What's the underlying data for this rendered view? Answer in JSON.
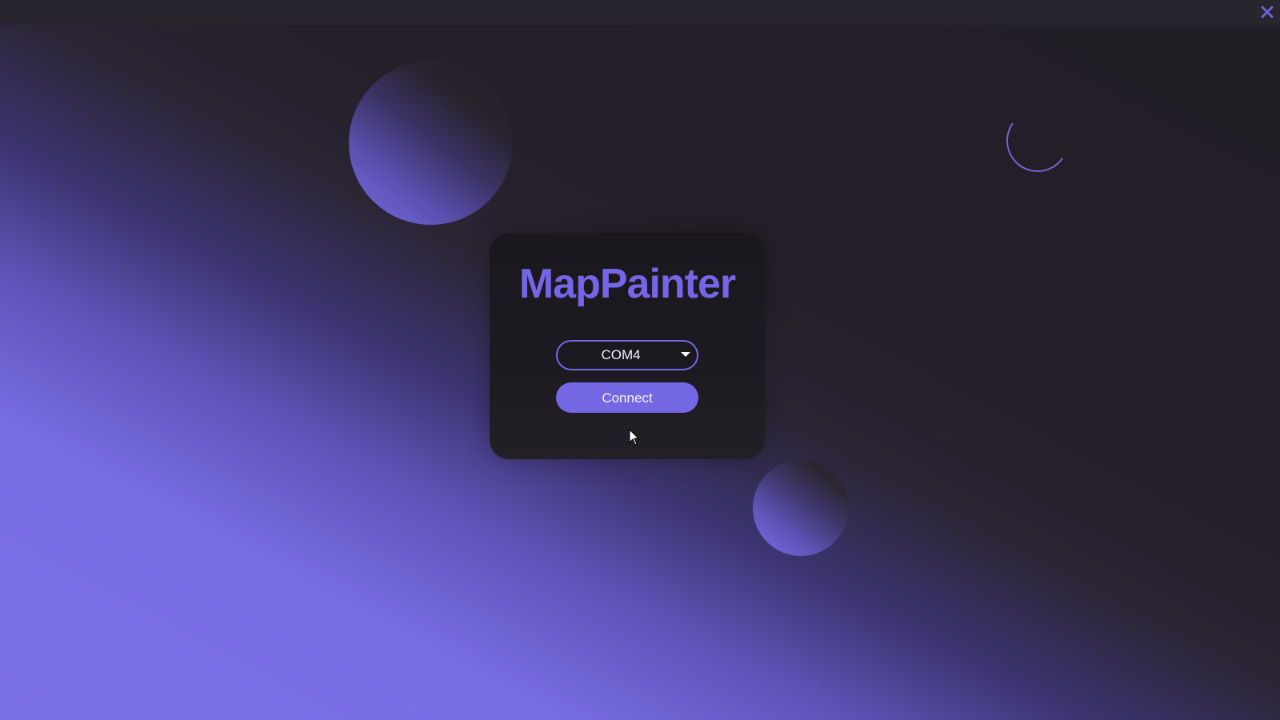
{
  "window": {
    "close_icon": "close-icon"
  },
  "app": {
    "title": "MapPainter"
  },
  "connection": {
    "port_selected": "COM4",
    "connect_label": "Connect"
  },
  "icons": {
    "dropdown": "chevron-down-icon",
    "cursor": "mouse-pointer-icon"
  },
  "colors": {
    "accent": "#7467e3",
    "background": "#231f27",
    "card": "#1c191f",
    "titlebar": "#29252f",
    "text": "#f2f0f8"
  }
}
